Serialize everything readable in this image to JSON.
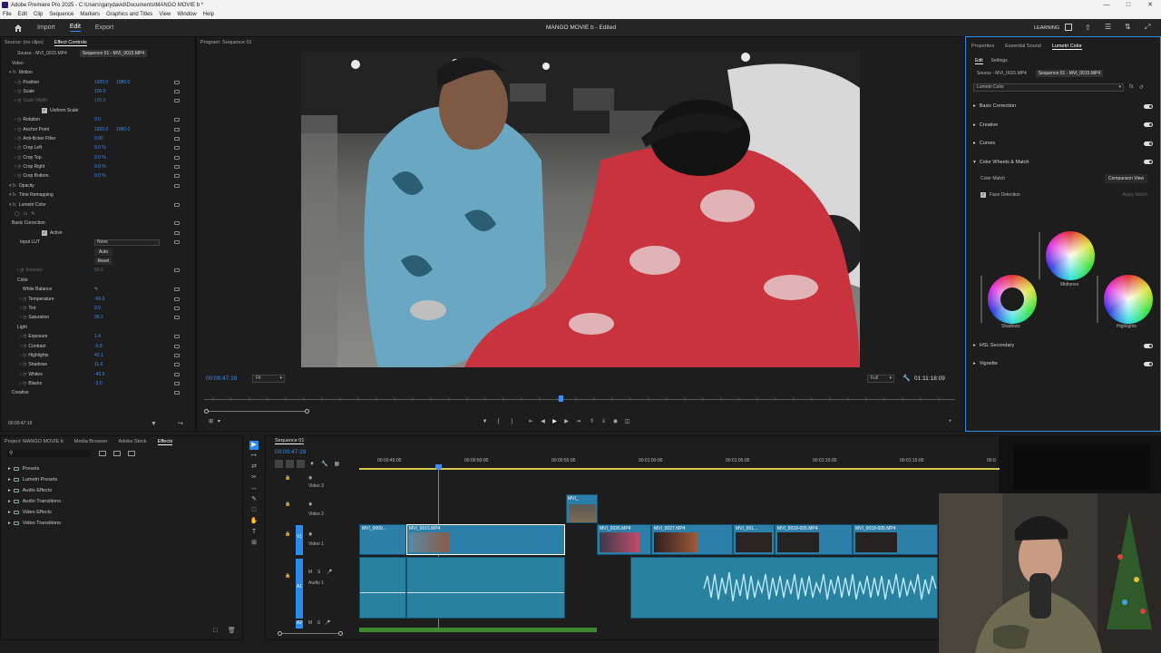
{
  "window": {
    "title": "Adobe Premiere Pro 2025 - C:\\Users\\garydavid\\Documents\\MANGO MOVIE b *"
  },
  "menu": [
    "File",
    "Edit",
    "Clip",
    "Sequence",
    "Markers",
    "Graphics and Titles",
    "View",
    "Window",
    "Help"
  ],
  "header": {
    "tabs": [
      "Import",
      "Edit",
      "Export"
    ],
    "project_title": "MANGO MOVIE b",
    "status": "- Edited",
    "workspace": "LEARNING"
  },
  "source_panel": {
    "tabs": [
      "Source: (no clips)",
      "Effect Controls"
    ],
    "source_tab": "Source - MVI_0015.MP4",
    "seq_tab": "Sequence 01 - MVI_0015.MP4"
  },
  "effect_controls": {
    "video_label": "Video",
    "rows": [
      {
        "label": "Motion",
        "indent": 1,
        "fx": true
      },
      {
        "label": "Position",
        "indent": 3,
        "v": "1920.0",
        "v2": "1080.0",
        "reset": true
      },
      {
        "label": "Scale",
        "indent": 3,
        "v": "100.0",
        "reset": true
      },
      {
        "label": "Scale Width",
        "indent": 3,
        "v": "100.0",
        "dim": true,
        "reset": true
      },
      {
        "label": "Uniform Scale",
        "indent": 13,
        "check": true
      },
      {
        "label": "Rotation",
        "indent": 3,
        "v": "0.0",
        "reset": true
      },
      {
        "label": "Anchor Point",
        "indent": 3,
        "v": "1920.0",
        "v2": "1080.0",
        "reset": true
      },
      {
        "label": "Anti-flicker Filter",
        "indent": 3,
        "v": "0.00",
        "reset": true
      },
      {
        "label": "Crop Left",
        "indent": 3,
        "v": "0.0 %",
        "reset": true
      },
      {
        "label": "Crop Top",
        "indent": 3,
        "v": "0.0 %",
        "reset": true
      },
      {
        "label": "Crop Right",
        "indent": 3,
        "v": "0.0 %",
        "reset": true
      },
      {
        "label": "Crop Bottom",
        "indent": 3,
        "v": "0.0 %",
        "reset": true
      },
      {
        "label": "Opacity",
        "indent": 1,
        "fx": true,
        "reset": true
      },
      {
        "label": "Time Remapping",
        "indent": 1,
        "fx": true
      },
      {
        "label": "Lumetri Color",
        "indent": 1,
        "fx": true,
        "reset": true
      },
      {
        "label": "",
        "indent": 3,
        "icons": true
      },
      {
        "label": "Basic Correction",
        "indent": 2,
        "reset": true
      },
      {
        "label": "Active",
        "indent": 13,
        "check": true,
        "reset": true
      },
      {
        "label": "Input LUT",
        "indent": 5,
        "select": "None",
        "reset": true
      },
      {
        "label": "",
        "indent": 13,
        "button": "Auto"
      },
      {
        "label": "",
        "indent": 13,
        "button": "Reset"
      },
      {
        "label": "Intensity",
        "indent": 4,
        "v": "50.0",
        "dim": true,
        "reset": true
      },
      {
        "label": "Color",
        "indent": 4
      },
      {
        "label": "White Balance",
        "indent": 6,
        "picker": true,
        "reset": true
      },
      {
        "label": "Temperature",
        "indent": 5,
        "v": "-66.9",
        "reset": true
      },
      {
        "label": "Tint",
        "indent": 5,
        "v": "9.9",
        "reset": true
      },
      {
        "label": "Saturation",
        "indent": 5,
        "v": "99.2",
        "reset": true
      },
      {
        "label": "Light",
        "indent": 4
      },
      {
        "label": "Exposure",
        "indent": 5,
        "v": "1.4",
        "reset": true
      },
      {
        "label": "Contrast",
        "indent": 5,
        "v": "-0.8",
        "reset": true
      },
      {
        "label": "Highlights",
        "indent": 5,
        "v": "42.1",
        "reset": true
      },
      {
        "label": "Shadows",
        "indent": 5,
        "v": "11.6",
        "reset": true
      },
      {
        "label": "Whites",
        "indent": 5,
        "v": "-40.5",
        "reset": true
      },
      {
        "label": "Blacks",
        "indent": 5,
        "v": "-3.0",
        "reset": true
      },
      {
        "label": "Creative",
        "indent": 2,
        "reset": true
      }
    ],
    "timecode": "00:00:47:19"
  },
  "program": {
    "title": "Program: Sequence 01",
    "timecode": "00:00:47:19",
    "fit": "Fit",
    "quality": "Full",
    "duration": "01:11:18:09"
  },
  "lumetri": {
    "tabs": [
      "Properties",
      "Essential Sound",
      "Lumetri Color"
    ],
    "subtabs": [
      "Edit",
      "Settings"
    ],
    "source_tab": "Source - MVI_0015.MP4",
    "seq_tab": "Sequence 01 - MVI_0015.MP4",
    "effect": "Lumetri Color",
    "sections": [
      "Basic Correction",
      "Creative",
      "Curves",
      "Color Wheels & Match"
    ],
    "color_match": "Color Match",
    "comparison_view": "Comparison View",
    "face_detection": "Face Detection",
    "apply_match": "Apply Match",
    "wheels": [
      "Midtones",
      "Shadows",
      "Highlights"
    ],
    "sections2": [
      "HSL Secondary",
      "Vignette"
    ]
  },
  "project_panel": {
    "tabs": [
      "Project: MANGO MOVIE b",
      "Media Browser",
      "Adobe Stock",
      "Effects"
    ],
    "folders": [
      "Presets",
      "Lumetri Presets",
      "Audio Effects",
      "Audio Transitions",
      "Video Effects",
      "Video Transitions"
    ]
  },
  "timeline": {
    "tab": "Sequence 01",
    "timecode": "00:00:47:19",
    "ruler": [
      "00:00:45:00",
      "00:00:50:00",
      "00:00:55:00",
      "00:01:00:00",
      "00:01:05:00",
      "00:01:10:00",
      "00:01:15:00",
      "00:0"
    ],
    "tracks": [
      {
        "id": "V3",
        "name": "Video 3"
      },
      {
        "id": "V2",
        "name": "Video 2"
      },
      {
        "id": "V1",
        "name": "Video 1"
      },
      {
        "id": "A1",
        "name": "Audio 1"
      },
      {
        "id": "A2",
        "name": ""
      }
    ],
    "v2_clip": "MVI_",
    "v1_clips": [
      "MVI_0009...",
      "MVI_0015.MP4",
      "MVI_0026.MP4",
      "MVI_0027.MP4",
      "MVI_001...",
      "MVI_0018-005.MP4",
      "MVI_0018-005.MP4"
    ]
  }
}
